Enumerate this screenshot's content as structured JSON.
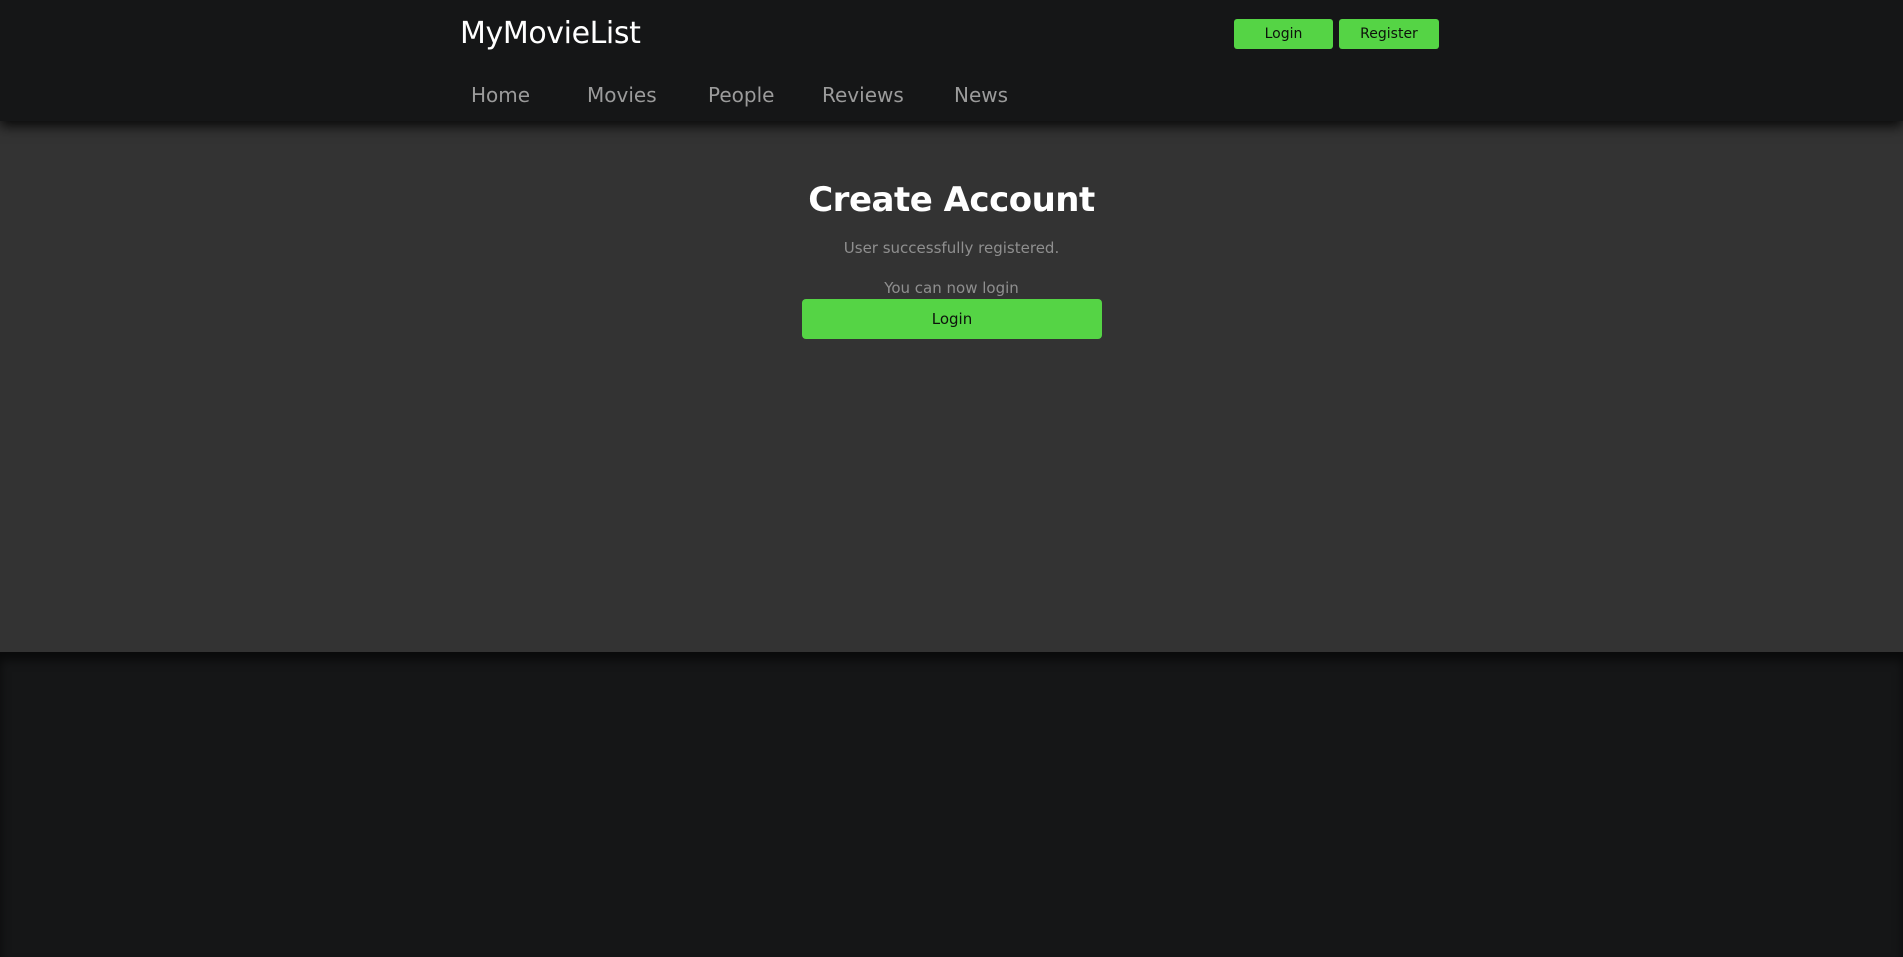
{
  "header": {
    "brand": "MyMovieList",
    "auth": {
      "login_label": "Login",
      "register_label": "Register"
    },
    "nav": {
      "items": [
        "Home",
        "Movies",
        "People",
        "Reviews",
        "News"
      ]
    }
  },
  "main": {
    "title": "Create Account",
    "messages": [
      "User successfully registered.",
      "You can now login"
    ],
    "login_label": "Login"
  },
  "colors": {
    "accent": "#55d445",
    "header_background": "#151617",
    "content_background": "#333333",
    "footer_background": "#151617"
  }
}
